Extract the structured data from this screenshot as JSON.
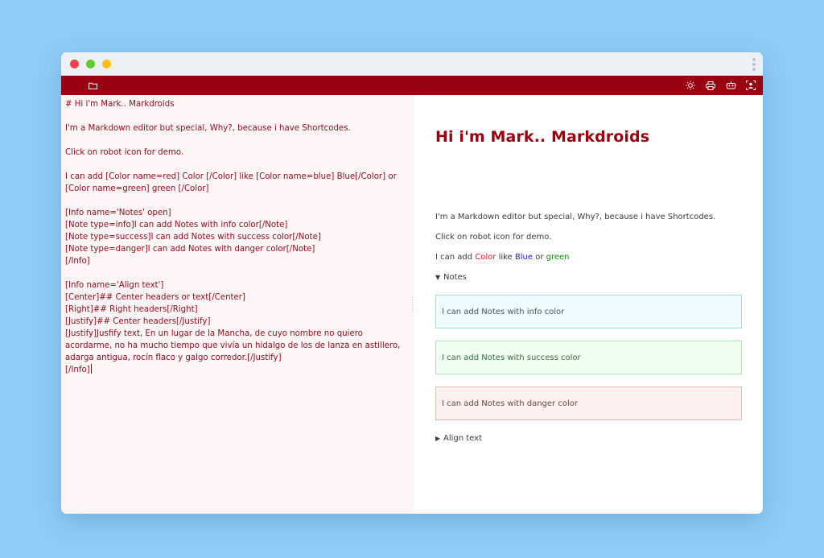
{
  "colors": {
    "background": "#8fcdf8",
    "toolbar": "#990010",
    "close_dot": "#f0414f",
    "minimize_dot": "#5fcb2e",
    "maximize_dot": "#fbbf1a",
    "editor_text": "#8a1020",
    "heading": "#990010",
    "red": "#e02020",
    "blue": "#1a1ac8",
    "green": "#0f8a0f",
    "info_bg": "#effcff",
    "info_border": "#9edcf0",
    "success_bg": "#eefff0",
    "success_border": "#a8ecb0",
    "danger_bg": "#fff0f0",
    "danger_border": "#f3b6b6"
  },
  "toolbar": {
    "left_icons": [
      "folder-icon"
    ],
    "right_icons": [
      "sun-icon",
      "printer-icon",
      "robot-icon",
      "user-icon"
    ]
  },
  "editor": {
    "lines": [
      "# Hi i'm Mark.. Markdroids",
      "",
      "I'm a Markdown editor but special, Why?, because i have Shortcodes.",
      "",
      "Click on robot icon for demo.",
      "",
      "I can add [Color name=red] Color [/Color] like [Color name=blue] Blue[/Color] or [Color name=green] green [/Color]",
      "",
      "[Info name='Notes' open]",
      "[Note type=info]I can add Notes with info color[/Note]",
      "[Note type=success]I can add Notes with success color[/Note]",
      "[Note type=danger]I can add Notes with danger color[/Note]",
      "[/Info]",
      "",
      "[Info name='Align text']",
      "[Center]## Center headers or text[/Center]",
      "[Right]## Right headers[/Right]",
      "[Justify]## Center headers[/Justify]",
      "[Justify]Jusfify text, En un lugar de la Mancha, de cuyo nombre no quiero acordarme, no ha mucho tiempo que vivía un hidalgo de los de lanza en astillero, adarga antigua, rocín flaco y galgo corredor.[/Justify]",
      "[/Info]"
    ]
  },
  "preview": {
    "heading": "Hi i'm Mark.. Markdroids",
    "intro": "I'm a Markdown editor but special, Why?, because i have Shortcodes.",
    "demo_hint": "Click on robot icon for demo.",
    "color_line": {
      "prefix": "I can add ",
      "red": "Color",
      "like": " like ",
      "blue": "Blue",
      "or": " or ",
      "green": "green"
    },
    "notes_summary": "Notes",
    "note_info": "I can add Notes with info color",
    "note_success": "I can add Notes with success color",
    "note_danger": "I can add Notes with danger color",
    "align_summary": "Align text",
    "open_triangle": "▼",
    "closed_triangle": "▶"
  }
}
